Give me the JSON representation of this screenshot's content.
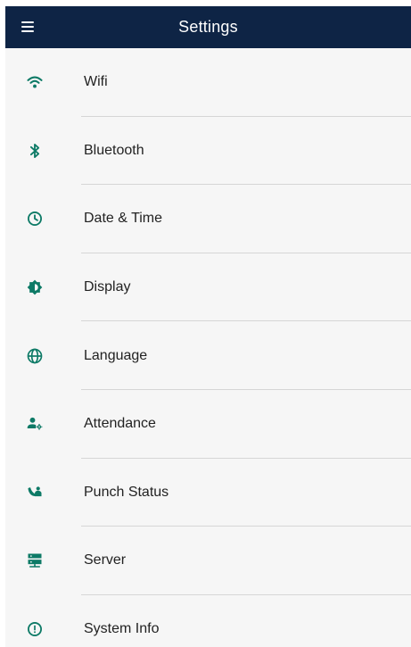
{
  "appbar": {
    "title": "Settings",
    "menu_icon": "hamburger-menu-icon",
    "background": "#0e2445"
  },
  "accent_color": "#0d7a66",
  "settings": [
    {
      "id": "wifi",
      "label": "Wifi",
      "icon": "wifi-icon"
    },
    {
      "id": "bluetooth",
      "label": "Bluetooth",
      "icon": "bluetooth-icon"
    },
    {
      "id": "date-time",
      "label": "Date & Time",
      "icon": "clock-icon"
    },
    {
      "id": "display",
      "label": "Display",
      "icon": "brightness-icon"
    },
    {
      "id": "language",
      "label": "Language",
      "icon": "globe-icon"
    },
    {
      "id": "attendance",
      "label": "Attendance",
      "icon": "user-settings-icon"
    },
    {
      "id": "punch-status",
      "label": "Punch Status",
      "icon": "phone-user-icon"
    },
    {
      "id": "server",
      "label": "Server",
      "icon": "server-icon"
    },
    {
      "id": "system-info",
      "label": "System Info",
      "icon": "info-icon"
    }
  ]
}
